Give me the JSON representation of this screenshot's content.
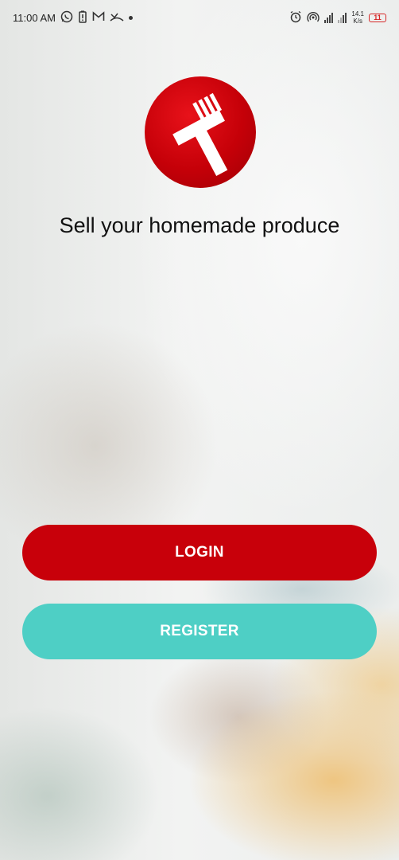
{
  "status_bar": {
    "time": "11:00 AM",
    "left_icons": [
      "whatsapp-icon",
      "battery-saver-icon",
      "gmail-icon",
      "missed-call-icon"
    ],
    "right_icons": [
      "alarm-icon",
      "hotspot-icon",
      "signal-icon"
    ],
    "net_speed_value": "14.1",
    "net_speed_unit": "K/s",
    "battery_level": "11",
    "battery_color": "#d62828"
  },
  "logo": {
    "icon": "fork-hammer-logo-icon",
    "color": "#c8000a"
  },
  "tagline": "Sell your homemade produce",
  "buttons": {
    "login_label": "LOGIN",
    "login_color": "#c8000a",
    "register_label": "REGISTER",
    "register_color": "#4ecfc5"
  }
}
